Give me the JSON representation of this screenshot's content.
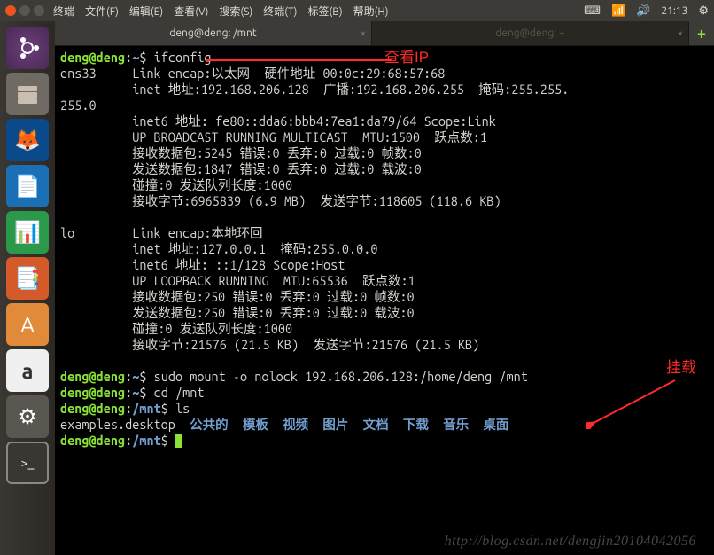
{
  "topbar": {
    "menus": [
      "终端",
      "文件(F)",
      "编辑(E)",
      "查看(V)",
      "搜索(S)",
      "终端(T)",
      "标签(B)",
      "帮助(H)"
    ],
    "tray_icons": [
      "keyboard-icon",
      "wifi-icon",
      "volume-icon",
      "clock-text",
      "gear-icon"
    ],
    "time": "21:13"
  },
  "launcher": {
    "items": [
      {
        "name": "ubuntu-dash",
        "glyph": "◌"
      },
      {
        "name": "files",
        "glyph": "🗄"
      },
      {
        "name": "firefox",
        "glyph": "🦊"
      },
      {
        "name": "libreoffice-writer",
        "glyph": "📄"
      },
      {
        "name": "libreoffice-calc",
        "glyph": "📊"
      },
      {
        "name": "libreoffice-impress",
        "glyph": "📑"
      },
      {
        "name": "ubuntu-software",
        "glyph": "A"
      },
      {
        "name": "amazon",
        "glyph": "a"
      },
      {
        "name": "system-settings",
        "glyph": "⚙"
      },
      {
        "name": "terminal",
        "glyph": ">_"
      }
    ]
  },
  "tabs": {
    "active": "deng@deng: /mnt",
    "inactive": "deng@deng: ~",
    "close": "×",
    "add": "+"
  },
  "term": {
    "prompt_user": "deng@deng",
    "home": "~",
    "mnt": "/mnt",
    "ps1_sep": ":",
    "ps1_end": "$ ",
    "cmd_ifconfig": "ifconfig",
    "ifconfig_output": "ens33     Link encap:以太网  硬件地址 00:0c:29:68:57:68  \n          inet 地址:192.168.206.128  广播:192.168.206.255  掩码:255.255.\n255.0\n          inet6 地址: fe80::dda6:bbb4:7ea1:da79/64 Scope:Link\n          UP BROADCAST RUNNING MULTICAST  MTU:1500  跃点数:1\n          接收数据包:5245 错误:0 丢弃:0 过载:0 帧数:0\n          发送数据包:1847 错误:0 丢弃:0 过载:0 载波:0\n          碰撞:0 发送队列长度:1000 \n          接收字节:6965839 (6.9 MB)  发送字节:118605 (118.6 KB)\n\nlo        Link encap:本地环回  \n          inet 地址:127.0.0.1  掩码:255.0.0.0\n          inet6 地址: ::1/128 Scope:Host\n          UP LOOPBACK RUNNING  MTU:65536  跃点数:1\n          接收数据包:250 错误:0 丢弃:0 过载:0 帧数:0\n          发送数据包:250 错误:0 丢弃:0 过载:0 载波:0\n          碰撞:0 发送队列长度:1000 \n          接收字节:21576 (21.5 KB)  发送字节:21576 (21.5 KB)\n",
    "cmd_mount": "sudo mount -o nolock 192.168.206.128:/home/deng /mnt",
    "cmd_cd": "cd /mnt",
    "cmd_ls": "ls",
    "ls_file": "examples.desktop",
    "ls_dirs": [
      "公共的",
      "模板",
      "视频",
      "图片",
      "文档",
      "下载",
      "音乐",
      "桌面"
    ]
  },
  "annotations": {
    "ip": "查看IP",
    "mount": "挂载"
  },
  "watermark": "http://blog.csdn.net/dengjin20104042056"
}
